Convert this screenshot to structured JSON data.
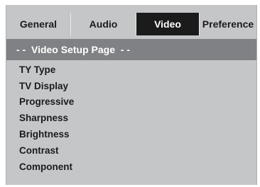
{
  "tabs": [
    {
      "label": "General",
      "active": false
    },
    {
      "label": "Audio",
      "active": false
    },
    {
      "label": "Video",
      "active": true
    },
    {
      "label": "Preference",
      "active": false
    }
  ],
  "page_title": "- -  Video Setup Page  - -",
  "menu_items": [
    "TY Type",
    "TV Display",
    "Progressive",
    "Sharpness",
    "Brightness",
    "Contrast",
    "Component"
  ],
  "colors": {
    "panel_bg": "#c5c6c8",
    "active_tab_bg": "#1b1b1b",
    "title_bar_bg": "#808184",
    "text": "#1b1b1b"
  }
}
